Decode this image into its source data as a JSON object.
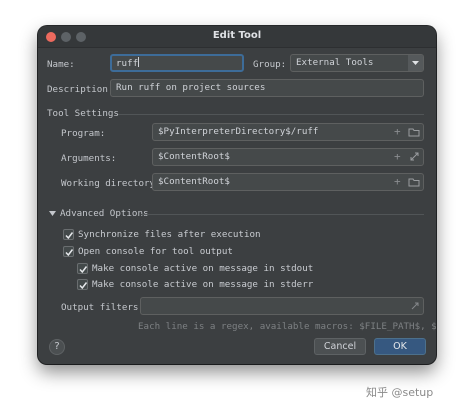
{
  "window": {
    "title": "Edit Tool",
    "traffic_lights": {
      "close": "#ed6a5e",
      "minimize": "#5d6266",
      "zoom": "#5d6266"
    }
  },
  "form": {
    "name_label": "Name:",
    "name_value": "ruff",
    "group_label": "Group:",
    "group_value": "External Tools",
    "description_label": "Description:",
    "description_value": "Run ruff on project sources"
  },
  "tool_settings": {
    "heading": "Tool Settings",
    "program_label": "Program:",
    "program_value": "$PyInterpreterDirectory$/ruff",
    "arguments_label": "Arguments:",
    "arguments_value": "$ContentRoot$",
    "working_dir_label": "Working directory:",
    "working_dir_value": "$ContentRoot$"
  },
  "advanced": {
    "heading": "Advanced Options",
    "sync_files_label": "Synchronize files after execution",
    "sync_files_checked": true,
    "open_console_label": "Open console for tool output",
    "open_console_checked": true,
    "console_stdout_label": "Make console active on message in stdout",
    "console_stdout_checked": true,
    "console_stderr_label": "Make console active on message in stderr",
    "console_stderr_checked": true,
    "output_filters_label": "Output filters:",
    "output_filters_value": "",
    "output_filters_hint": "Each line is a regex, available macros: $FILE_PATH$, $LI..."
  },
  "footer": {
    "help_label": "?",
    "cancel_label": "Cancel",
    "ok_label": "OK"
  },
  "icons": {
    "dropdown": "chevron-down-icon",
    "add": "plus-icon",
    "folder": "folder-icon",
    "expand": "expand-icon",
    "section_toggle": "triangle-down-icon"
  },
  "colors": {
    "window_bg": "#3c3f41",
    "field_bg": "#45494a",
    "focus_border": "#3d6c99",
    "ok_button": "#365880"
  },
  "watermark": "知乎 @setup"
}
